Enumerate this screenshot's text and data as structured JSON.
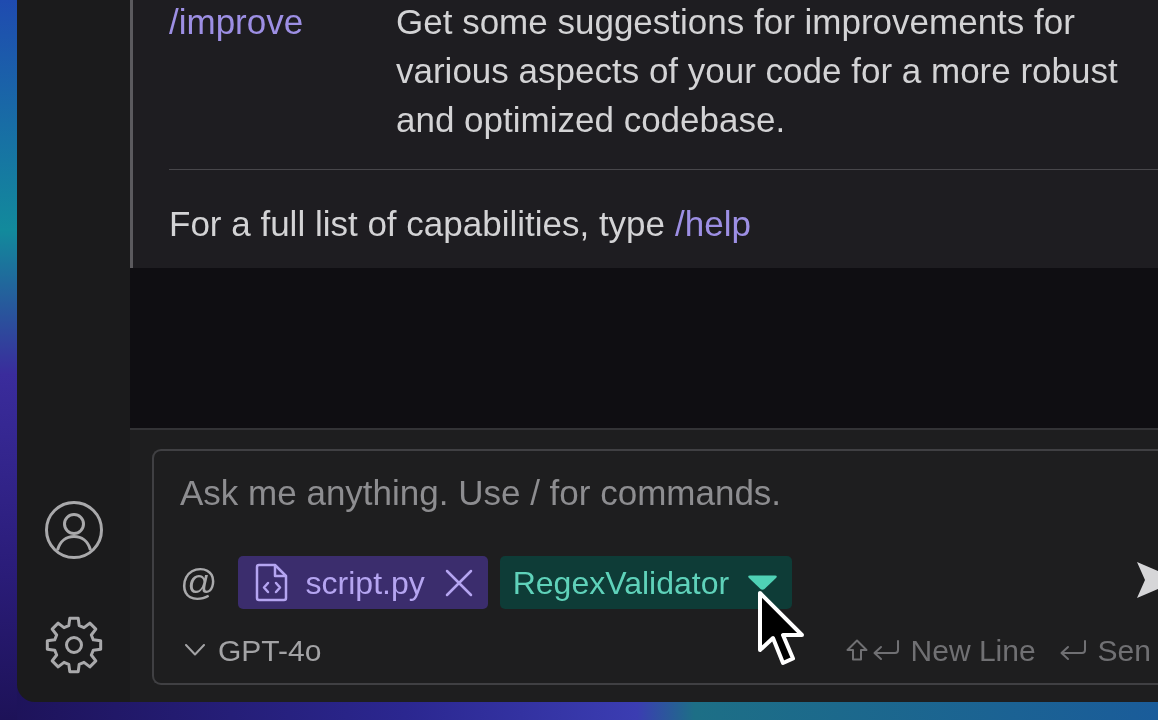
{
  "conversation": {
    "commands": [
      {
        "command": "/improve",
        "description": "Get some suggestions for improvements for various aspects of your code for a more robust and optimized codebase."
      }
    ],
    "help_hint": {
      "text": "For a full list of capabilities, type",
      "command": "/help"
    }
  },
  "composer": {
    "placeholder": "Ask me anything. Use / for commands.",
    "mention_button": "@",
    "context_chips": [
      {
        "kind": "file",
        "label": "script.py"
      },
      {
        "kind": "agent",
        "label": "RegexValidator"
      }
    ],
    "model": "GPT-4o",
    "shortcuts": [
      {
        "kind": "newline",
        "label": "New Line"
      },
      {
        "kind": "send",
        "label": "Sen"
      }
    ]
  }
}
